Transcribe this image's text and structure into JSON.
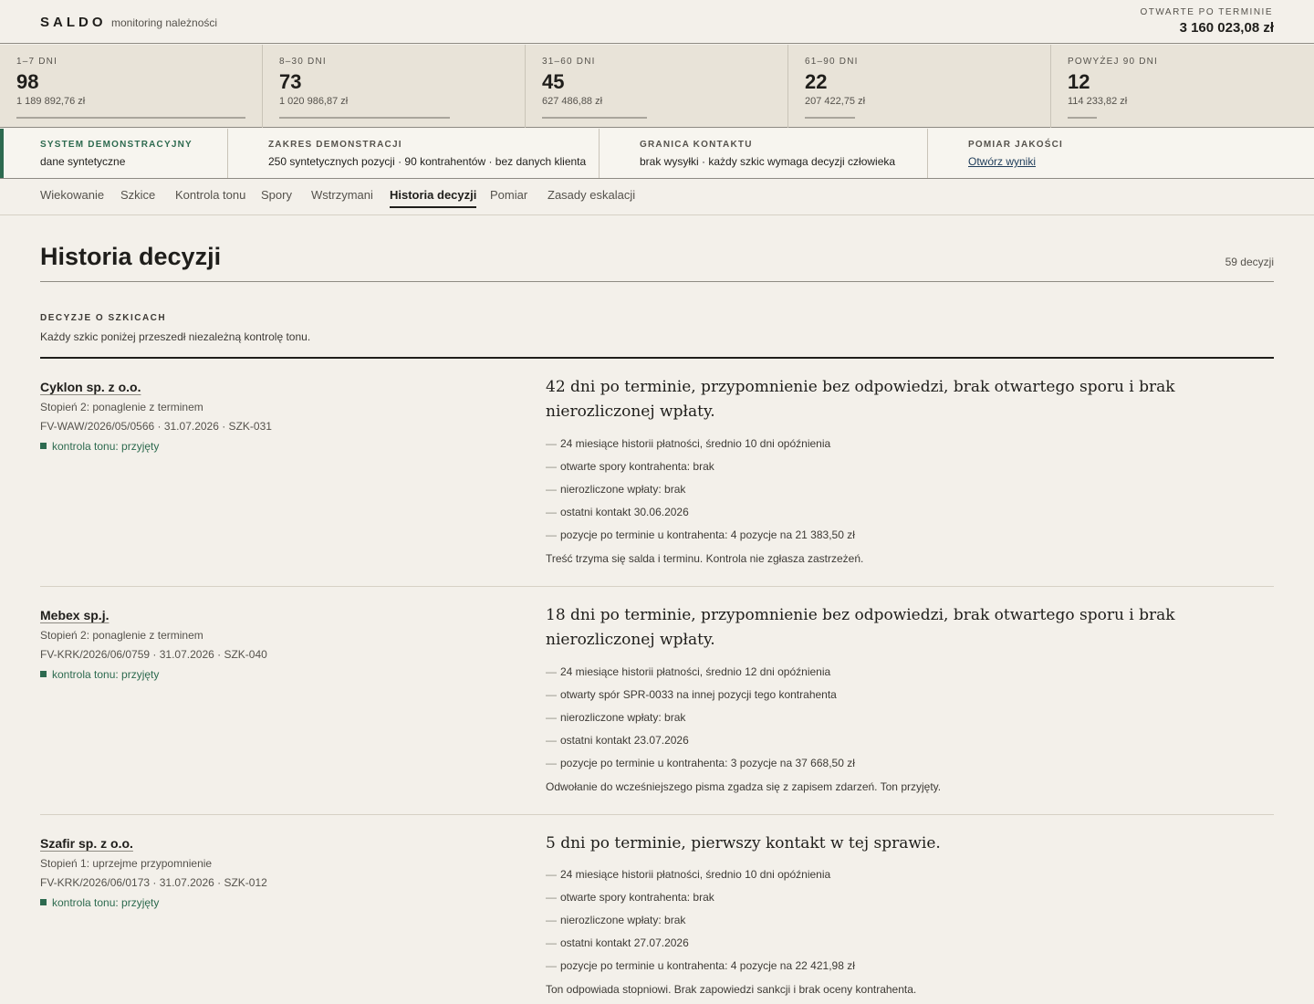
{
  "app": {
    "brand": "SALDO",
    "subtitle": "monitoring należności",
    "overdue_label": "OTWARTE PO TERMINIE",
    "overdue_total": "3 160 023,08 zł"
  },
  "buckets": [
    {
      "label": "1–7 DNI",
      "count": "98",
      "amount": "1 189 892,76 zł",
      "share": 0.87
    },
    {
      "label": "8–30 DNI",
      "count": "73",
      "amount": "1 020 986,87 zł",
      "share": 0.65
    },
    {
      "label": "31–60 DNI",
      "count": "45",
      "amount": "627 486,88 zł",
      "share": 0.4
    },
    {
      "label": "61–90 DNI",
      "count": "22",
      "amount": "207 422,75 zł",
      "share": 0.19
    },
    {
      "label": "POWYŻEJ 90 DNI",
      "count": "12",
      "amount": "114 233,82 zł",
      "share": 0.11
    }
  ],
  "info": {
    "system_label": "SYSTEM DEMONSTRACYJNY",
    "system_value": "dane syntetyczne",
    "scope_label": "ZAKRES DEMONSTRACJI",
    "scope_value": "250 syntetycznych pozycji · 90 kontrahentów · bez danych klienta",
    "contact_label": "GRANICA KONTAKTU",
    "contact_value": "brak wysyłki · każdy szkic wymaga decyzji człowieka",
    "quality_label": "POMIAR JAKOŚCI",
    "quality_link": "Otwórz wyniki"
  },
  "nav": {
    "items": [
      "Wiekowanie",
      "Szkice",
      "Kontrola tonu",
      "Spory",
      "Wstrzymani",
      "Historia decyzji",
      "Pomiar",
      "Zasady eskalacji"
    ],
    "active": "Historia decyzji"
  },
  "page": {
    "title": "Historia decyzji",
    "count": "59 decyzji",
    "section_label": "DECYZJE O SZKICACH",
    "section_sub": "Każdy szkic poniżej przeszedł niezależną kontrolę tonu."
  },
  "decisions": [
    {
      "client": "Cyklon sp. z o.o.",
      "stage": "Stopień 2: ponaglenie z terminem",
      "ref": "FV-WAW/2026/05/0566 · 31.07.2026 · SZK-031",
      "tone": "kontrola tonu: przyjęty",
      "summary": "42 dni po terminie, przypomnienie bez odpowiedzi, brak otwartego sporu i brak nierozliczonej wpłaty.",
      "facts": [
        "24 miesiące historii płatności, średnio 10 dni opóźnienia",
        "otwarte spory kontrahenta: brak",
        "nierozliczone wpłaty: brak",
        "ostatni kontakt 30.06.2026",
        "pozycje po terminie u kontrahenta: 4 pozycje na 21 383,50 zł"
      ],
      "verdict": "Treść trzyma się salda i terminu. Kontrola nie zgłasza zastrzeżeń."
    },
    {
      "client": "Mebex sp.j.",
      "stage": "Stopień 2: ponaglenie z terminem",
      "ref": "FV-KRK/2026/06/0759 · 31.07.2026 · SZK-040",
      "tone": "kontrola tonu: przyjęty",
      "summary": "18 dni po terminie, przypomnienie bez odpowiedzi, brak otwartego sporu i brak nierozliczonej wpłaty.",
      "facts": [
        "24 miesiące historii płatności, średnio 12 dni opóźnienia",
        "otwarty spór SPR-0033 na innej pozycji tego kontrahenta",
        "nierozliczone wpłaty: brak",
        "ostatni kontakt 23.07.2026",
        "pozycje po terminie u kontrahenta: 3 pozycje na 37 668,50 zł"
      ],
      "verdict": "Odwołanie do wcześniejszego pisma zgadza się z zapisem zdarzeń. Ton przyjęty."
    },
    {
      "client": "Szafir sp. z o.o.",
      "stage": "Stopień 1: uprzejme przypomnienie",
      "ref": "FV-KRK/2026/06/0173 · 31.07.2026 · SZK-012",
      "tone": "kontrola tonu: przyjęty",
      "summary": "5 dni po terminie, pierwszy kontakt w tej sprawie.",
      "facts": [
        "24 miesiące historii płatności, średnio 10 dni opóźnienia",
        "otwarte spory kontrahenta: brak",
        "nierozliczone wpłaty: brak",
        "ostatni kontakt 27.07.2026",
        "pozycje po terminie u kontrahenta: 4 pozycje na 22 421,98 zł"
      ],
      "verdict": "Ton odpowiada stopniowi. Brak zapowiedzi sankcji i brak oceny kontrahenta."
    }
  ]
}
